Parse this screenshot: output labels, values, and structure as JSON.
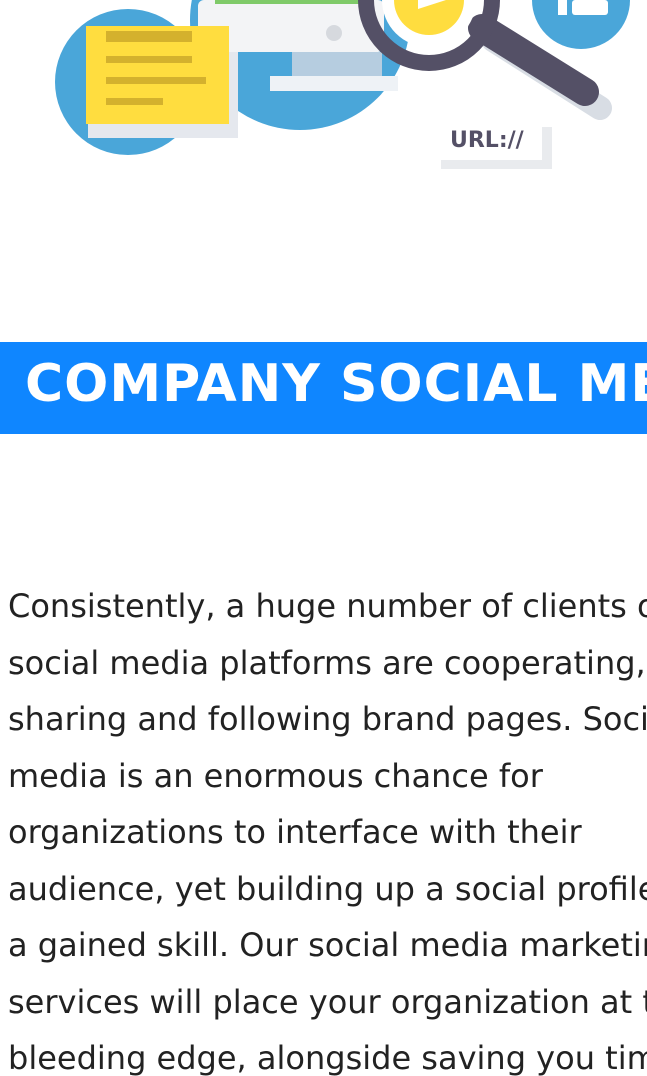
{
  "hero": {
    "url_label": "URL://"
  },
  "section": {
    "heading": "COMPANY SOCIAL MEDIA",
    "body_lines": [
      "Consistently, a huge number of clients on",
      "social media platforms are cooperating,",
      "sharing and following brand pages. Social",
      "media is an enormous chance for",
      "organizations to interface with their",
      "audience, yet building up a social profile is",
      "a gained skill. Our social media marketing",
      "services will place your organization at the",
      "bleeding edge, alongside saving you time."
    ]
  },
  "colors": {
    "accent": "#0f86ff",
    "text": "#222222",
    "illustration_blue": "#4aa6d9",
    "note_yellow": "#ffdd3f",
    "magnifier_dark": "#545066"
  }
}
